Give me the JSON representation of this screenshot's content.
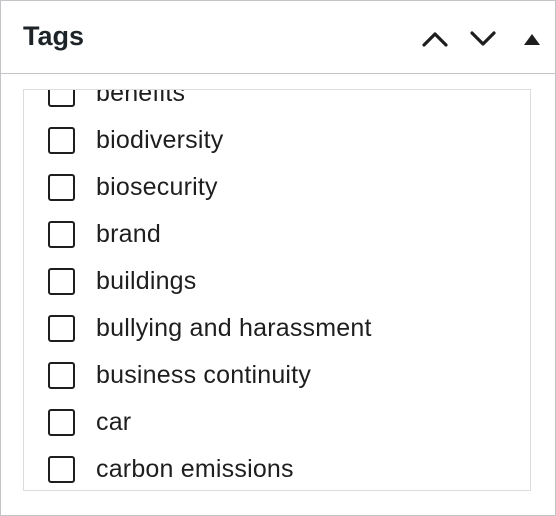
{
  "panel": {
    "title": "Tags",
    "controls": [
      {
        "icon": "chevron-up-icon",
        "label": "Move up"
      },
      {
        "icon": "chevron-down-icon",
        "label": "Move down"
      },
      {
        "icon": "triangle-up-icon",
        "label": "Toggle panel"
      }
    ]
  },
  "tags": {
    "items": [
      {
        "label": "benefits",
        "checked": false
      },
      {
        "label": "biodiversity",
        "checked": false
      },
      {
        "label": "biosecurity",
        "checked": false
      },
      {
        "label": "brand",
        "checked": false
      },
      {
        "label": "buildings",
        "checked": false
      },
      {
        "label": "bullying and harassment",
        "checked": false
      },
      {
        "label": "business continuity",
        "checked": false
      },
      {
        "label": "car",
        "checked": false
      },
      {
        "label": "carbon emissions",
        "checked": false
      }
    ]
  },
  "colors": {
    "border": "#c3c4c7",
    "text": "#1e1e1e",
    "title": "#1d2327"
  }
}
